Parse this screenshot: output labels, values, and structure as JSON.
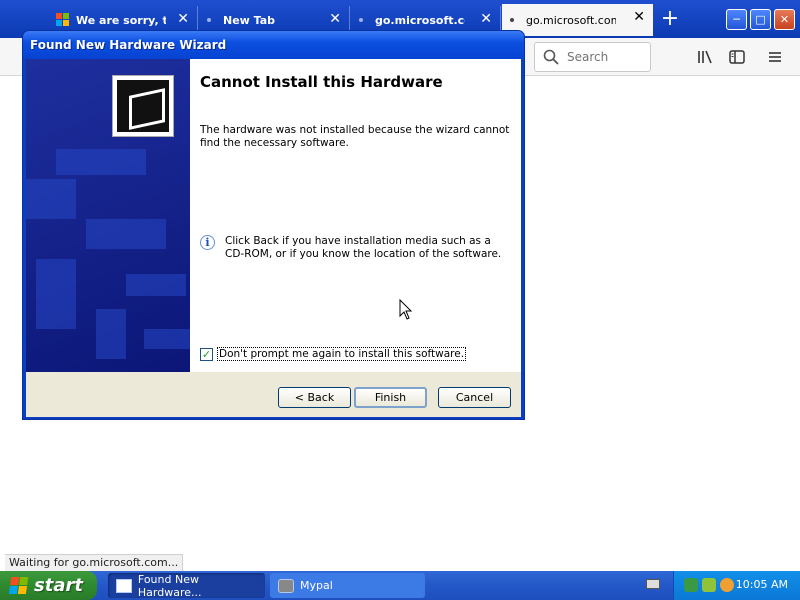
{
  "browser": {
    "tabs": [
      {
        "label": "We are sorry, the p",
        "close": "✕"
      },
      {
        "label": "New Tab",
        "close": "✕"
      },
      {
        "label": "go.microsoft.com/f",
        "close": "✕"
      },
      {
        "label": "go.microsoft.com/f",
        "close": "✕"
      }
    ],
    "new_tab": "+",
    "search_placeholder": "Search",
    "status_text": "Waiting for go.microsoft.com..."
  },
  "wizard": {
    "title": "Found New Hardware Wizard",
    "heading": "Cannot Install this Hardware",
    "message": "The hardware was not installed because the wizard cannot find the necessary software.",
    "hint": "Click Back if you have installation media such as a CD-ROM, or if you know the location of the software.",
    "checkbox_label": "Don't prompt me again to install this software.",
    "checkbox_checked": true,
    "buttons": {
      "back": "< Back",
      "finish": "Finish",
      "cancel": "Cancel"
    }
  },
  "taskbar": {
    "start_label": "start",
    "items": [
      {
        "label": "Found New Hardware..."
      },
      {
        "label": "Mypal"
      }
    ],
    "clock": "10:05 AM"
  },
  "colors": {
    "xp_blue": "#2457c8",
    "start_green": "#2f8a2f",
    "wizard_titlebar": "#0c4fe0",
    "dialog_face": "#ece9d8"
  }
}
